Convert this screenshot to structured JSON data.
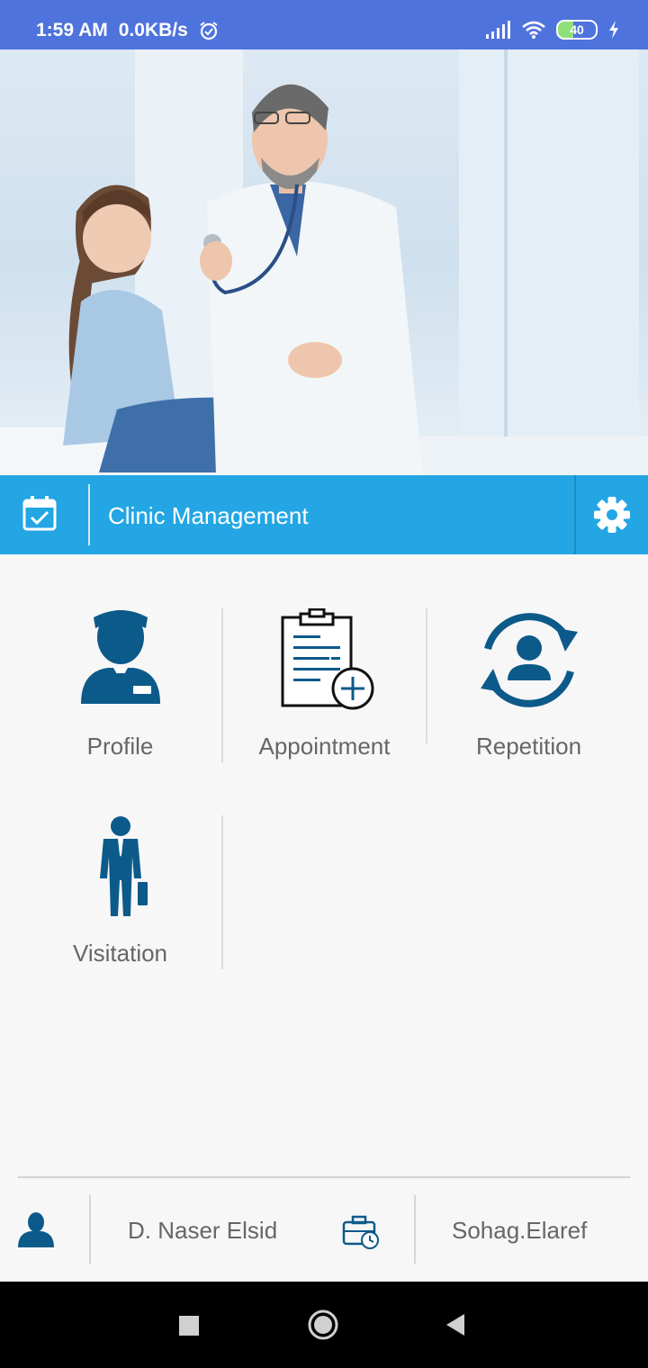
{
  "status_bar": {
    "time": "1:59 AM",
    "net_speed": "0.0KB/s",
    "battery": "40",
    "icons": [
      "alarm-icon",
      "signal-icon",
      "wifi-icon",
      "battery-icon",
      "charging-icon"
    ]
  },
  "header": {
    "title": "Clinic Management",
    "left_icon": "calendar-check-icon",
    "right_icon": "gear-icon",
    "color": "#24a6e4"
  },
  "menu": {
    "items": [
      {
        "label": "Profile",
        "icon": "doctor-profile-icon"
      },
      {
        "label": "Appointment",
        "icon": "clipboard-add-icon"
      },
      {
        "label": "Repetition",
        "icon": "user-repeat-icon"
      },
      {
        "label": "Visitation",
        "icon": "businessman-icon"
      }
    ],
    "icon_color": "#0c5a8a"
  },
  "footer": {
    "doctor_name": "D. Naser Elsid",
    "clinic_location": "Sohag.Elaref"
  }
}
